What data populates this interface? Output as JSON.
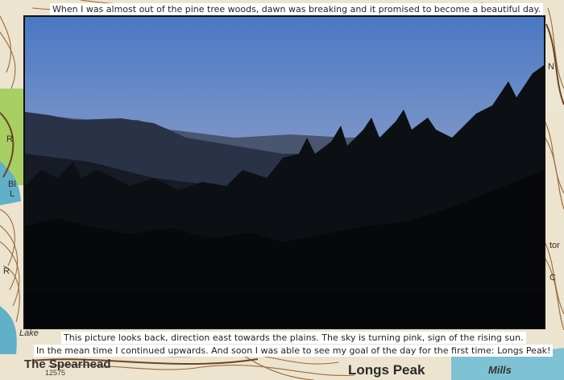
{
  "captions": {
    "top": "When I was almost out of the pine tree woods, dawn was breaking and it promised to become a beautiful day.",
    "bottom_line1": "This picture looks back, direction east towards the plains. The sky is turning pink, sign of the rising sun.",
    "bottom_line2": "In the mean time I continued upwards. And soon I was able to see my goal of the day for the first time: Longs Peak!"
  },
  "map_labels": {
    "spearhead": "The Spearhead",
    "longs_peak": "Longs Peak",
    "lake": "Lake",
    "mills": "Mills",
    "elevation": "12575"
  },
  "colors": {
    "map_background": "#e9e2cf",
    "contour": "#9a6a3c",
    "water": "#5fb0c8",
    "forest": "#a8cf63",
    "sky_top": "#4a78c4",
    "sky_horizon": "#c9b7c9"
  }
}
